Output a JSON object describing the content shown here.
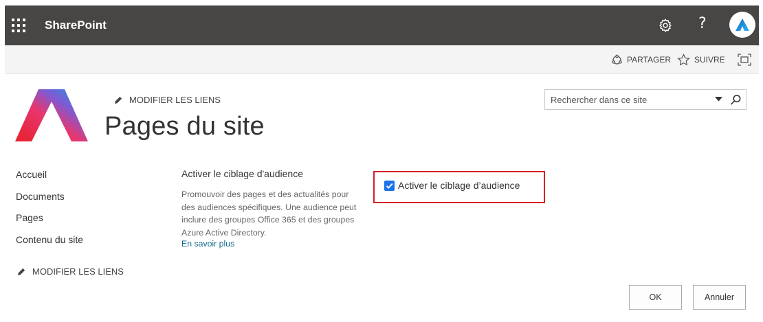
{
  "suite_bar": {
    "app_name": "SharePoint",
    "waffle_icon": "app-launcher-icon",
    "settings_icon": "gear-icon",
    "help_label": "?",
    "background_color": "#484644"
  },
  "command_bar": {
    "share_label": "PARTAGER",
    "follow_label": "SUIVRE",
    "focus_icon": "focus-mode-icon"
  },
  "header": {
    "edit_links_label": "MODIFIER LES LIENS",
    "site_title": "Pages du site",
    "search_placeholder": "Rechercher dans ce site"
  },
  "left_nav": {
    "items": [
      {
        "label": "Accueil"
      },
      {
        "label": "Documents"
      },
      {
        "label": "Pages"
      },
      {
        "label": "Contenu du site"
      }
    ],
    "edit_links_label": "MODIFIER LES LIENS"
  },
  "section": {
    "title": "Activer le ciblage d'audience",
    "description": "Promouvoir des pages et des actualités pour des audiences spécifiques. Une audience peut inclure des groupes Office 365 et des groupes Azure Active Directory.",
    "learn_more": "En savoir plus",
    "checkbox_label": "Activer le ciblage d’audience",
    "checkbox_checked": true,
    "highlight_color": "#d41f26",
    "link_color": "#0f6a8c"
  },
  "buttons": {
    "ok": "OK",
    "cancel": "Annuler"
  }
}
